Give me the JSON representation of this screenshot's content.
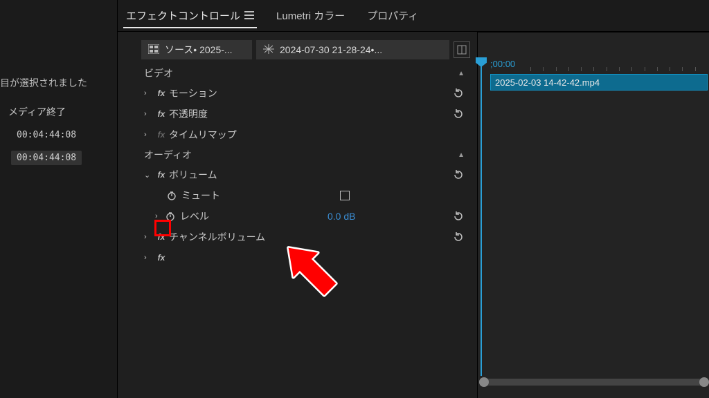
{
  "sidebar": {
    "selection_text": "目が選択されました",
    "media_end_label": "メディア終了",
    "tc1": "00:04:44:08",
    "tc2": "00:04:44:08"
  },
  "tabs": {
    "effect_controls": "エフェクトコントロール",
    "lumetri": "Lumetri カラー",
    "properties": "プロパティ"
  },
  "source_bar": {
    "source_label": "ソース• 2025-...",
    "clip_label": "2024-07-30 21-28-24•..."
  },
  "sections": {
    "video": "ビデオ",
    "audio": "オーディオ"
  },
  "video_effects": {
    "motion": "モーション",
    "opacity": "不透明度",
    "time_remap": "タイムリマップ"
  },
  "audio_effects": {
    "volume": "ボリューム",
    "mute": "ミュート",
    "level": "レベル",
    "level_value": "0.0 dB",
    "channel_volume": "チャンネルボリューム",
    "hidden": ""
  },
  "timeline": {
    "playhead_time": "00:00",
    "clip_name": "2025-02-03 14-42-42.mp4"
  },
  "colors": {
    "accent": "#2a9fd6",
    "highlight_red": "#ff0000",
    "link_blue": "#3b8fd6"
  },
  "icons": {
    "reset": "reset-icon",
    "stopwatch": "stopwatch-icon",
    "fx": "fx-icon",
    "master_clip": "master-clip-icon",
    "show_hide": "show-hide-icon",
    "menu": "hamburger-icon"
  }
}
